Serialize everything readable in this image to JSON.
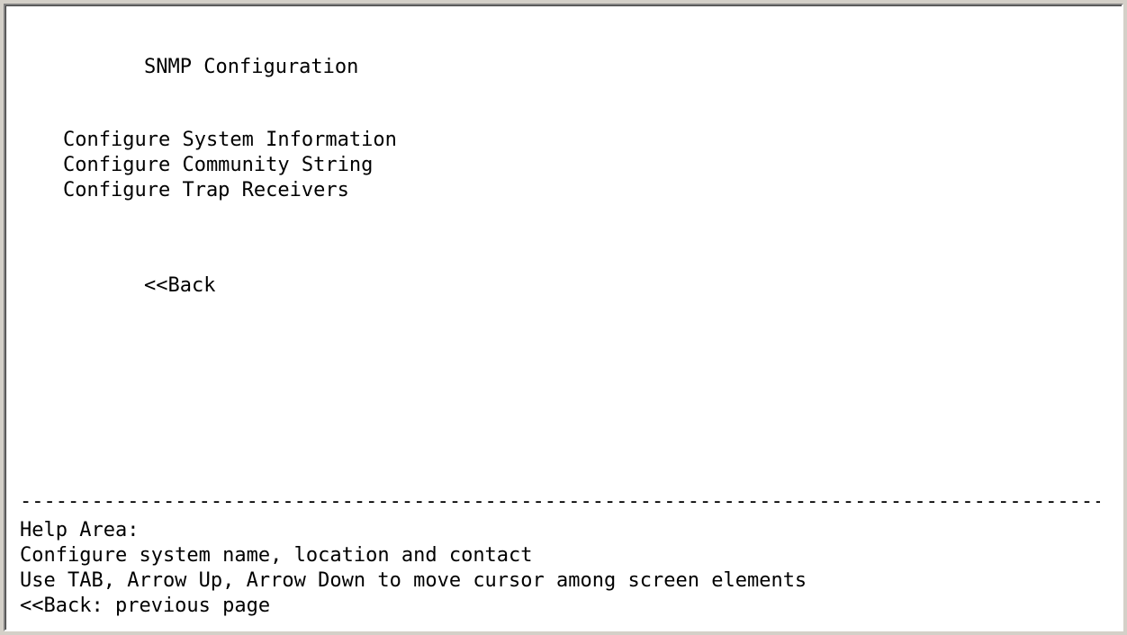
{
  "screen": {
    "title": "SNMP Configuration",
    "menu": [
      {
        "label": "Configure System Information"
      },
      {
        "label": "Configure Community String"
      },
      {
        "label": "Configure Trap Receivers"
      }
    ],
    "back_label": "<<Back",
    "divider": "----------------------------------------------------------------------------------------------------------------"
  },
  "help": {
    "title": "Help Area:",
    "lines": [
      "Configure system name, location and contact",
      "Use TAB, Arrow Up, Arrow Down to move cursor among screen elements",
      "<<Back: previous page"
    ]
  },
  "colors": {
    "background": "#ffffff",
    "text": "#000000",
    "frame": "#d4d0c8"
  }
}
